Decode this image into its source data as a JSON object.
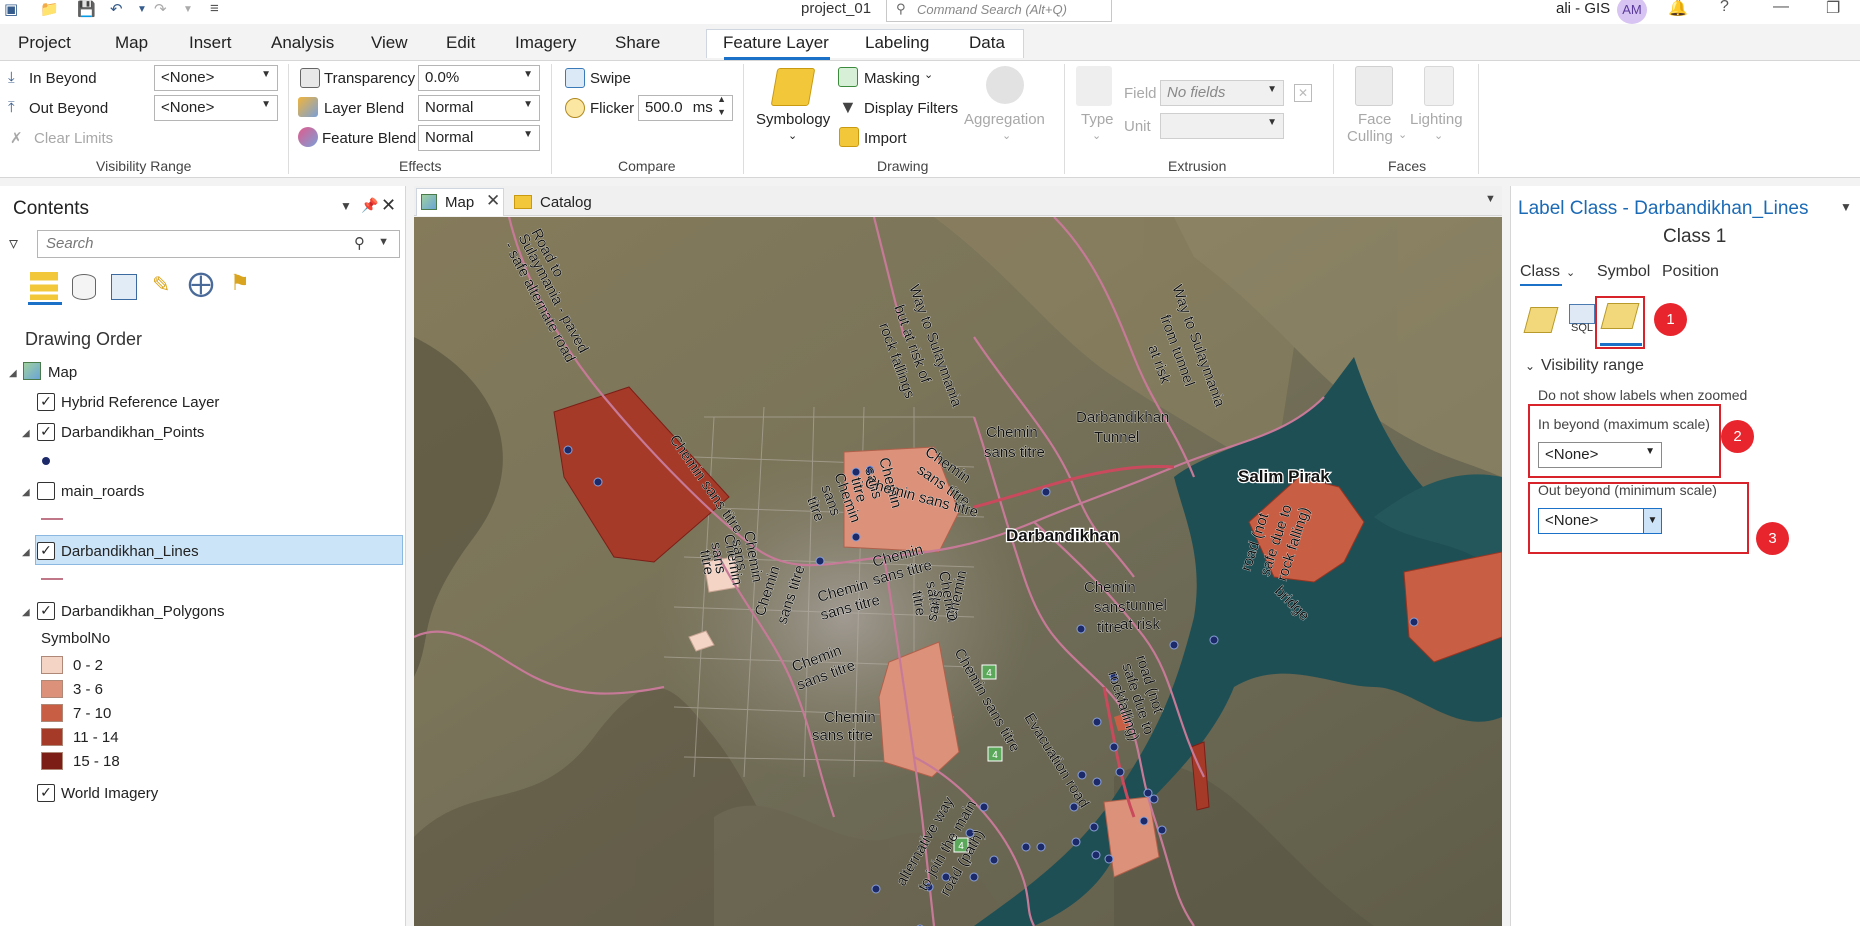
{
  "titlebar": {
    "project": "project_01",
    "command_search_placeholder": "Command Search (Alt+Q)",
    "user": "ali - GIS",
    "avatar_initials": "AM"
  },
  "tabs": [
    "Project",
    "Map",
    "Insert",
    "Analysis",
    "View",
    "Edit",
    "Imagery",
    "Share"
  ],
  "context_tabs": [
    "Feature Layer",
    "Labeling",
    "Data"
  ],
  "ribbon": {
    "visibility_range": {
      "label": "Visibility Range",
      "in_beyond": "In Beyond",
      "out_beyond": "Out Beyond",
      "clear_limits": "Clear Limits",
      "in_value": "<None>",
      "out_value": "<None>"
    },
    "effects": {
      "label": "Effects",
      "transparency": "Transparency",
      "transparency_value": "0.0%",
      "layer_blend": "Layer Blend",
      "layer_blend_value": "Normal",
      "feature_blend": "Feature Blend",
      "feature_blend_value": "Normal"
    },
    "compare": {
      "label": "Compare",
      "swipe": "Swipe",
      "flicker": "Flicker",
      "flicker_value": "500.0",
      "flicker_unit": "ms"
    },
    "drawing": {
      "label": "Drawing",
      "symbology": "Symbology",
      "masking": "Masking",
      "display_filters": "Display Filters",
      "import": "Import",
      "aggregation": "Aggregation"
    },
    "extrusion": {
      "label": "Extrusion",
      "type": "Type",
      "field": "Field",
      "field_value": "No fields",
      "unit": "Unit"
    },
    "faces": {
      "label": "Faces",
      "face": "Face",
      "culling": "Culling",
      "lighting": "Lighting"
    }
  },
  "contents": {
    "title": "Contents",
    "search_placeholder": "Search",
    "drawing_order": "Drawing Order",
    "map": "Map",
    "layers": [
      "Hybrid Reference Layer",
      "Darbandikhan_Points",
      "main_roards",
      "Darbandikhan_Lines",
      "Darbandikhan_Polygons"
    ],
    "symbol_field": "SymbolNo",
    "classes": [
      {
        "label": "0 - 2",
        "color": "#f3d4c5"
      },
      {
        "label": "3 - 6",
        "color": "#dc917a"
      },
      {
        "label": "7 - 10",
        "color": "#c85f45"
      },
      {
        "label": "11 - 14",
        "color": "#a53a29"
      },
      {
        "label": "15 - 18",
        "color": "#7c1e16"
      }
    ],
    "basemap": "World Imagery"
  },
  "map_tabs": {
    "map": "Map",
    "catalog": "Catalog"
  },
  "map_labels": {
    "road_to_sulaymania": "Road to",
    "sulaymania_paved": "Sulaymania - paved",
    "safe_alternate": "- safe alternate road",
    "way_to_sulaymania_1": "Way to Sulaymania",
    "but_at_risk": "but at risk of",
    "rock_fallings": "rock fallings",
    "way_to_sulaymania_2": "Way to Sulaymania",
    "from_tunnel": "from tunnel",
    "at_risk": "at risk",
    "chemin": "Chemin",
    "sans": "sans",
    "titre": "titre",
    "chemin_sans_titre": "Chemin sans titre",
    "sans_titre": "sans titre",
    "darbandikhan_town": "Darbandikhan",
    "darbandikhan_tunnel": "Darbandikhan",
    "tunnel": "Tunnel",
    "salim_pirak": "Salim Pirak",
    "road_not_safe": "road (not",
    "safe_due_to": "safe due to",
    "rock_falling": "rock falling)",
    "bridge": "bridge",
    "tunnel_at_risk_1": "tunnel",
    "tunnel_at_risk_2": "at risk",
    "road_not_2": "road (not",
    "safe_due_2": "safe due to",
    "rock_falling_2": "rockfalling)",
    "evacuation_road": "Evacuation road",
    "alternative_way": "alternative way",
    "to_join_main": "to join the main",
    "road_path": "road (path)",
    "shield_4": "4"
  },
  "label_panel": {
    "title": "Label Class - Darbandikhan_Lines",
    "subtitle": "Class 1",
    "tabs": [
      "Class",
      "Symbol",
      "Position"
    ],
    "sql": "SQL",
    "section": "Visibility range",
    "hint": "Do not show labels when zoomed",
    "in_beyond": "In beyond (maximum scale)",
    "in_value": "<None>",
    "out_beyond": "Out beyond (minimum scale)",
    "out_value": "<None>",
    "badges": [
      "1",
      "2",
      "3"
    ]
  }
}
